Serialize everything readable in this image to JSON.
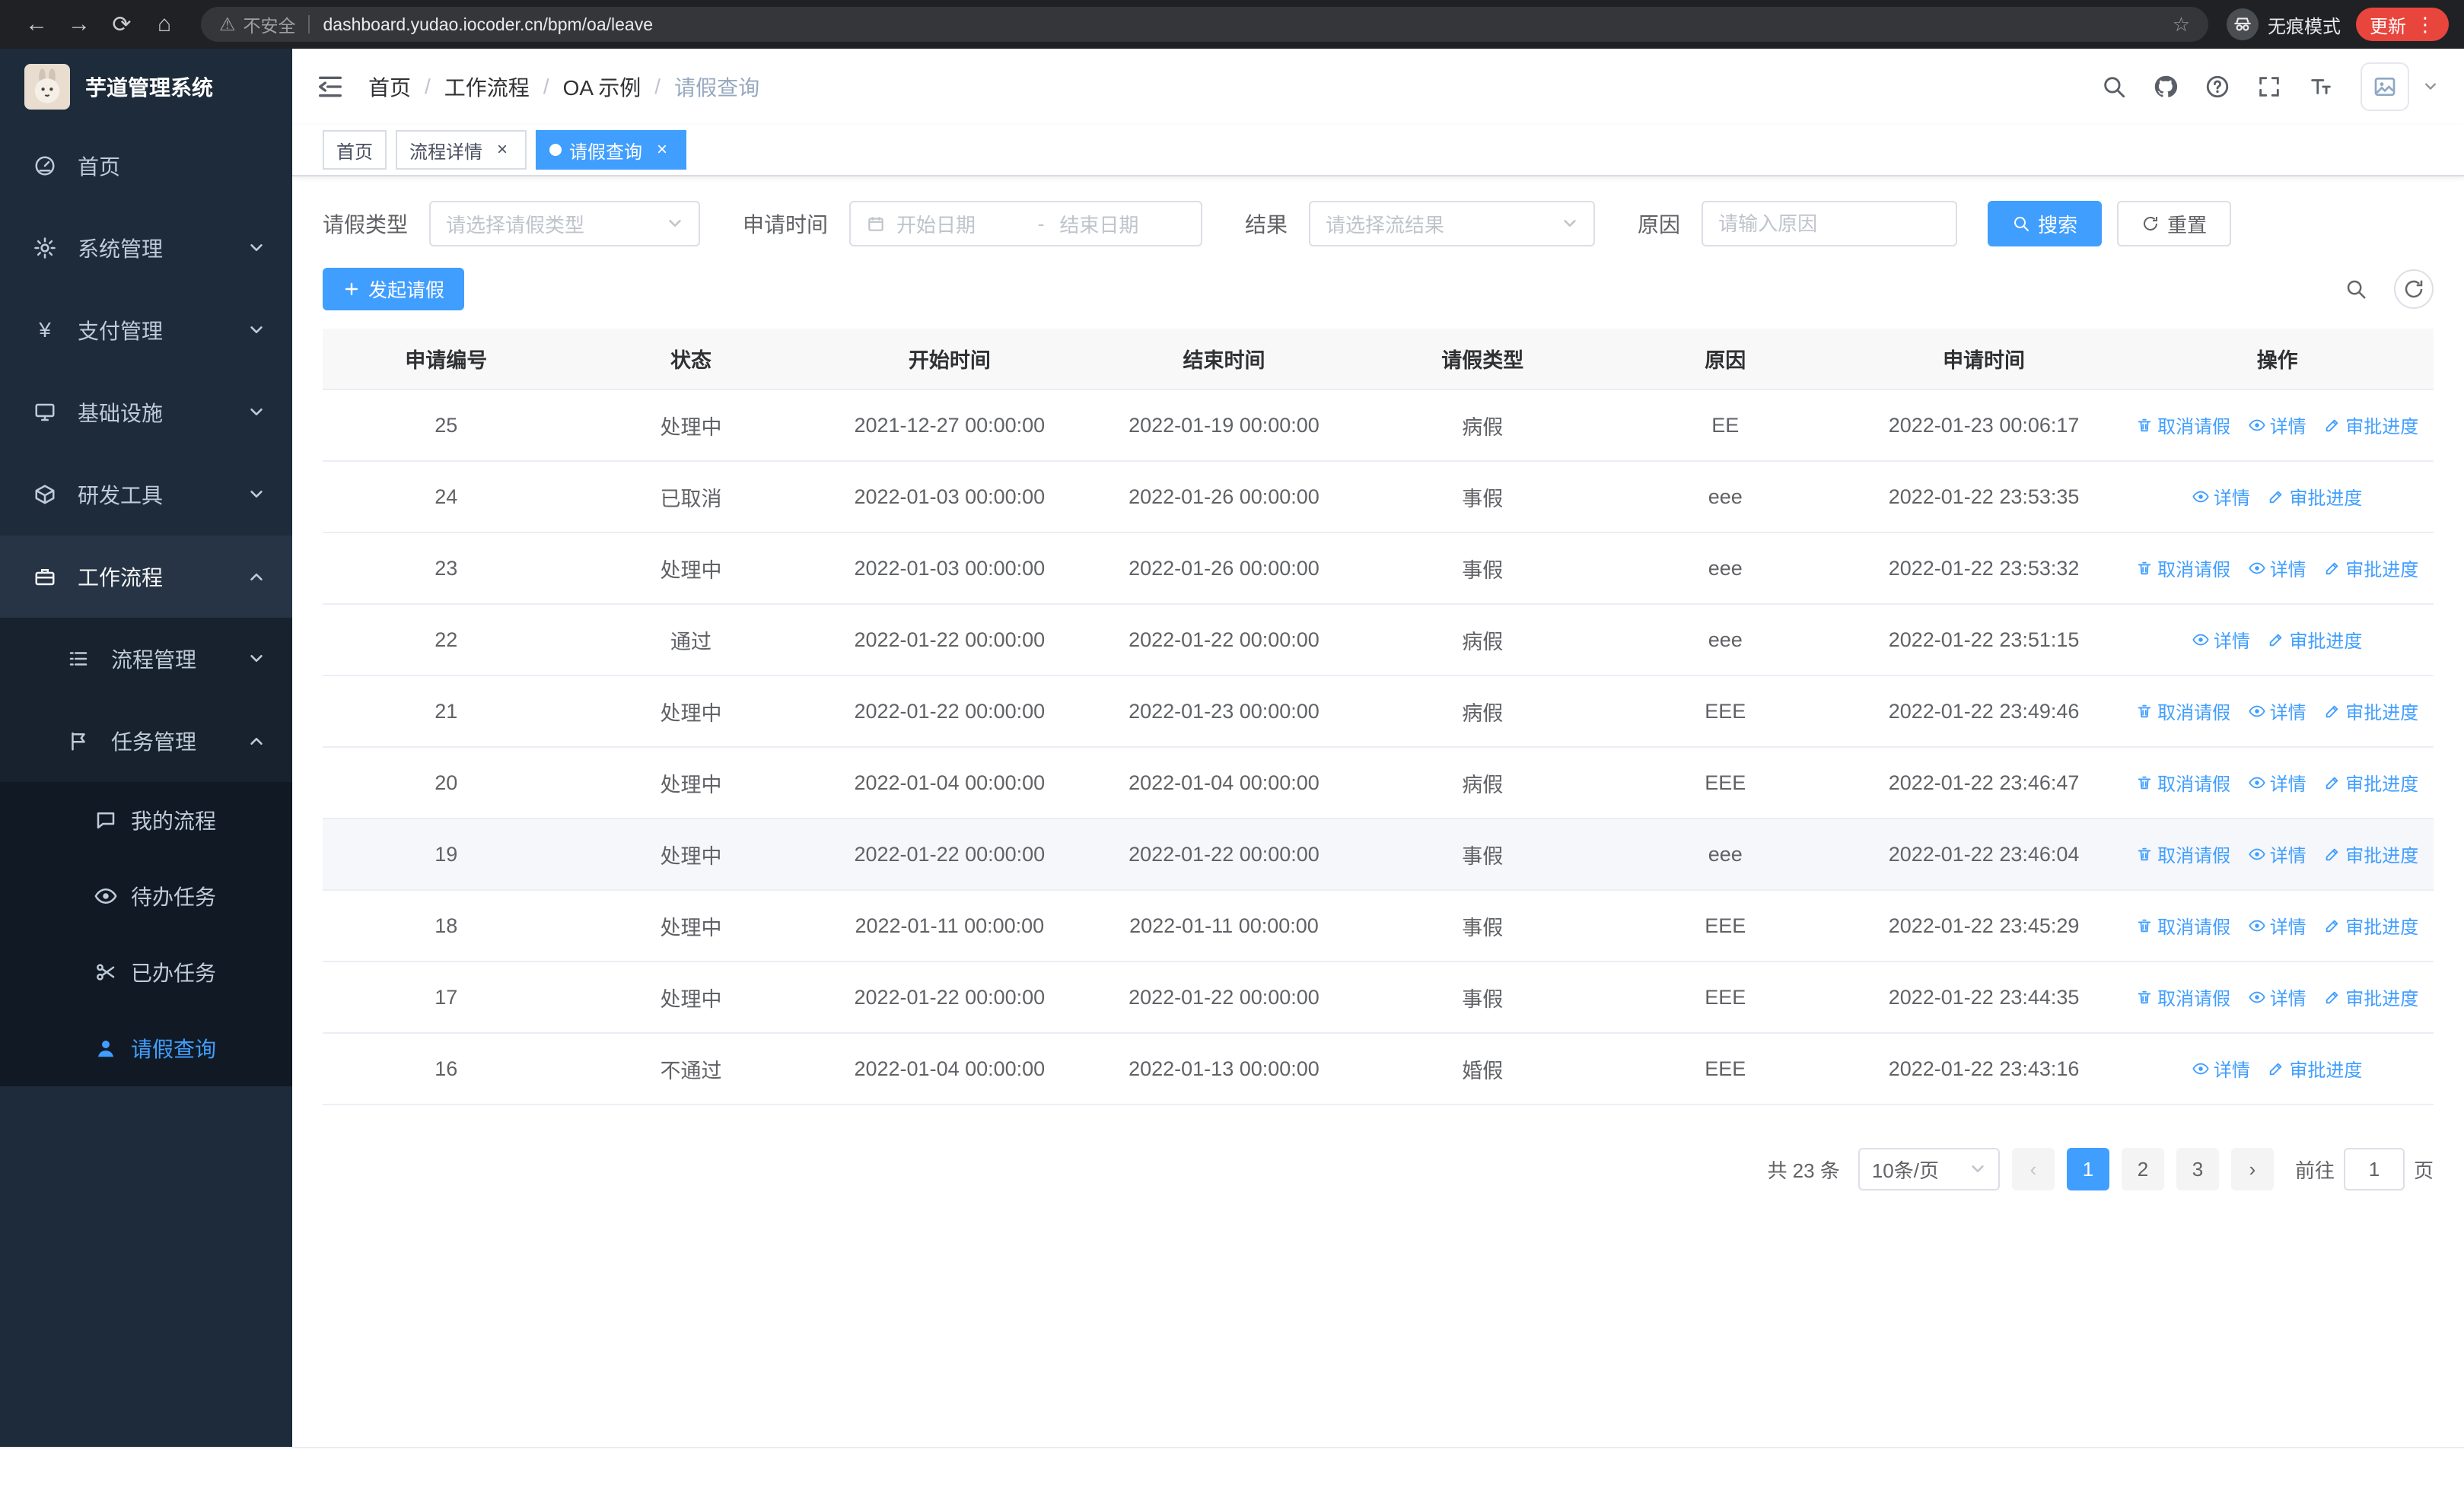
{
  "browser": {
    "security_label": "不安全",
    "url": "dashboard.yudao.iocoder.cn/bpm/oa/leave",
    "incognito_label": "无痕模式",
    "update_label": "更新"
  },
  "icons": {
    "back": "←",
    "forward": "→",
    "reload": "⟳",
    "home": "⌂",
    "warning": "⚠",
    "star": "☆",
    "kebab": "⋮",
    "close": "×",
    "yen": "¥",
    "prev": "‹",
    "next": "›"
  },
  "sidebar": {
    "logo_title": "芋道管理系统",
    "home": "首页",
    "system": "系统管理",
    "payment": "支付管理",
    "infra": "基础设施",
    "devtools": "研发工具",
    "workflow": "工作流程",
    "process_mgmt": "流程管理",
    "task_mgmt": "任务管理",
    "my_process": "我的流程",
    "todo_task": "待办任务",
    "done_task": "已办任务",
    "leave_query": "请假查询"
  },
  "breadcrumb": {
    "items": [
      "首页",
      "工作流程",
      "OA 示例",
      "请假查询"
    ],
    "separator": "/"
  },
  "tabs": {
    "home": "首页",
    "process_detail": "流程详情",
    "leave_query": "请假查询"
  },
  "filter": {
    "leave_type_label": "请假类型",
    "leave_type_placeholder": "请选择请假类型",
    "apply_time_label": "申请时间",
    "start_placeholder": "开始日期",
    "separator": "-",
    "end_placeholder": "结束日期",
    "result_label": "结果",
    "result_placeholder": "请选择流结果",
    "reason_label": "原因",
    "reason_placeholder": "请输入原因",
    "search_label": "搜索",
    "reset_label": "重置"
  },
  "toolbar": {
    "create_label": "发起请假"
  },
  "table": {
    "columns": [
      "申请编号",
      "状态",
      "开始时间",
      "结束时间",
      "请假类型",
      "原因",
      "申请时间",
      "操作"
    ],
    "op_cancel": "取消请假",
    "op_detail": "详情",
    "op_progress": "审批进度",
    "rows": [
      {
        "no": "25",
        "status": "处理中",
        "start": "2021-12-27 00:00:00",
        "end": "2022-01-19 00:00:00",
        "type": "病假",
        "reason": "EE",
        "applied": "2022-01-23 00:06:17"
      },
      {
        "no": "24",
        "status": "已取消",
        "start": "2022-01-03 00:00:00",
        "end": "2022-01-26 00:00:00",
        "type": "事假",
        "reason": "eee",
        "applied": "2022-01-22 23:53:35"
      },
      {
        "no": "23",
        "status": "处理中",
        "start": "2022-01-03 00:00:00",
        "end": "2022-01-26 00:00:00",
        "type": "事假",
        "reason": "eee",
        "applied": "2022-01-22 23:53:32"
      },
      {
        "no": "22",
        "status": "通过",
        "start": "2022-01-22 00:00:00",
        "end": "2022-01-22 00:00:00",
        "type": "病假",
        "reason": "eee",
        "applied": "2022-01-22 23:51:15"
      },
      {
        "no": "21",
        "status": "处理中",
        "start": "2022-01-22 00:00:00",
        "end": "2022-01-23 00:00:00",
        "type": "病假",
        "reason": "EEE",
        "applied": "2022-01-22 23:49:46"
      },
      {
        "no": "20",
        "status": "处理中",
        "start": "2022-01-04 00:00:00",
        "end": "2022-01-04 00:00:00",
        "type": "病假",
        "reason": "EEE",
        "applied": "2022-01-22 23:46:47"
      },
      {
        "no": "19",
        "status": "处理中",
        "start": "2022-01-22 00:00:00",
        "end": "2022-01-22 00:00:00",
        "type": "事假",
        "reason": "eee",
        "applied": "2022-01-22 23:46:04"
      },
      {
        "no": "18",
        "status": "处理中",
        "start": "2022-01-11 00:00:00",
        "end": "2022-01-11 00:00:00",
        "type": "事假",
        "reason": "EEE",
        "applied": "2022-01-22 23:45:29"
      },
      {
        "no": "17",
        "status": "处理中",
        "start": "2022-01-22 00:00:00",
        "end": "2022-01-22 00:00:00",
        "type": "事假",
        "reason": "EEE",
        "applied": "2022-01-22 23:44:35"
      },
      {
        "no": "16",
        "status": "不通过",
        "start": "2022-01-04 00:00:00",
        "end": "2022-01-13 00:00:00",
        "type": "婚假",
        "reason": "EEE",
        "applied": "2022-01-22 23:43:16"
      }
    ]
  },
  "pagination": {
    "total": "共 23 条",
    "size": "10条/页",
    "page1": "1",
    "page2": "2",
    "page3": "3",
    "goto_label": "前往",
    "goto_value": "1",
    "unit_label": "页"
  },
  "colors": {
    "primary": "#409eff",
    "sidebar_bg": "#1d2b3a",
    "active_tab_bg": "#409eff",
    "update_badge": "#e8453c",
    "chrome_bg": "#202124"
  }
}
